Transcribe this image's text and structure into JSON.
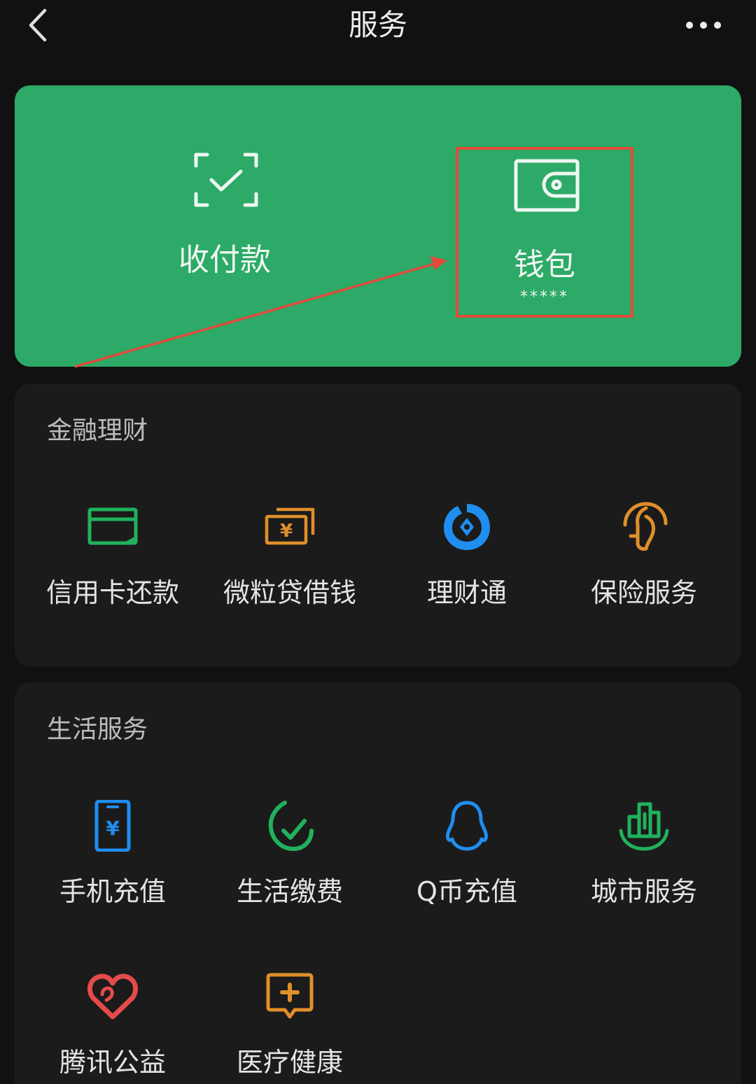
{
  "header": {
    "title": "服务"
  },
  "main_card": {
    "pay": {
      "label": "收付款",
      "icon": "qr-scan-check-icon"
    },
    "wallet": {
      "label": "钱包",
      "balance": "*****",
      "icon": "wallet-icon"
    }
  },
  "sections": {
    "finance": {
      "title": "金融理财",
      "items": [
        {
          "label": "信用卡还款",
          "icon": "credit-card-icon",
          "color": "#21b15d"
        },
        {
          "label": "微粒贷借钱",
          "icon": "banknote-icon",
          "color": "#e08f2b"
        },
        {
          "label": "理财通",
          "icon": "licaitong-icon",
          "color": "#1f8ef0"
        },
        {
          "label": "保险服务",
          "icon": "insurance-umbrella-icon",
          "color": "#e08f2b"
        }
      ]
    },
    "life": {
      "title": "生活服务",
      "items": [
        {
          "label": "手机充值",
          "icon": "phone-topup-icon",
          "color": "#1f8ef0"
        },
        {
          "label": "生活缴费",
          "icon": "utility-bill-icon",
          "color": "#21b15d"
        },
        {
          "label": "Q币充值",
          "icon": "qq-penguin-icon",
          "color": "#1f8ef0"
        },
        {
          "label": "城市服务",
          "icon": "city-building-icon",
          "color": "#21b15d"
        },
        {
          "label": "腾讯公益",
          "icon": "charity-heart-icon",
          "color": "#e64b4b"
        },
        {
          "label": "医疗健康",
          "icon": "medical-chat-icon",
          "color": "#e08f2b"
        }
      ]
    }
  },
  "colors": {
    "background": "#111111",
    "card_green": "#2daa67",
    "section_bg": "#1b1b1b",
    "highlight_red": "#e24a3b"
  }
}
